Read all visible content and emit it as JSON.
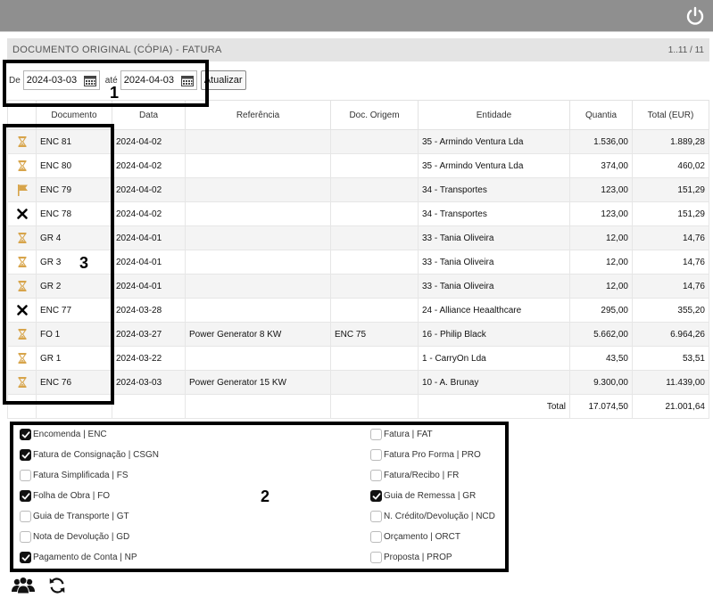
{
  "header": {
    "power_icon": "power-icon"
  },
  "panel": {
    "title": "DOCUMENTO ORIGINAL (CÓPIA) - FATURA",
    "pagination": "1..11 / 11"
  },
  "filter": {
    "from_label": "De",
    "from_value": "2024-03-03",
    "to_label": "até",
    "to_value": "2024-04-03",
    "refresh_label": "Atualizar"
  },
  "markers": {
    "m1": "1",
    "m2": "2",
    "m3": "3"
  },
  "table": {
    "columns": [
      "Documento",
      "Data",
      "Referência",
      "Doc. Origem",
      "Entidade",
      "Quantia",
      "Total (EUR)"
    ],
    "rows": [
      {
        "status": "hourglass",
        "doc": "ENC 81",
        "date": "2024-04-02",
        "ref": "",
        "origin": "",
        "entity": "35 - Armindo Ventura Lda",
        "qty": "1.536,00",
        "total": "1.889,28"
      },
      {
        "status": "hourglass",
        "doc": "ENC 80",
        "date": "2024-04-02",
        "ref": "",
        "origin": "",
        "entity": "35 - Armindo Ventura Lda",
        "qty": "374,00",
        "total": "460,02"
      },
      {
        "status": "flag",
        "doc": "ENC 79",
        "date": "2024-04-02",
        "ref": "",
        "origin": "",
        "entity": "34 - Transportes",
        "qty": "123,00",
        "total": "151,29"
      },
      {
        "status": "cross",
        "doc": "ENC 78",
        "date": "2024-04-02",
        "ref": "",
        "origin": "",
        "entity": "34 - Transportes",
        "qty": "123,00",
        "total": "151,29"
      },
      {
        "status": "hourglass",
        "doc": "GR 4",
        "date": "2024-04-01",
        "ref": "",
        "origin": "",
        "entity": "33 - Tania Oliveira",
        "qty": "12,00",
        "total": "14,76"
      },
      {
        "status": "hourglass",
        "doc": "GR 3",
        "date": "2024-04-01",
        "ref": "",
        "origin": "",
        "entity": "33 - Tania Oliveira",
        "qty": "12,00",
        "total": "14,76"
      },
      {
        "status": "hourglass",
        "doc": "GR 2",
        "date": "2024-04-01",
        "ref": "",
        "origin": "",
        "entity": "33 - Tania Oliveira",
        "qty": "12,00",
        "total": "14,76"
      },
      {
        "status": "cross",
        "doc": "ENC 77",
        "date": "2024-03-28",
        "ref": "",
        "origin": "",
        "entity": "24 - Alliance Heaalthcare",
        "qty": "295,00",
        "total": "355,20"
      },
      {
        "status": "hourglass",
        "doc": "FO 1",
        "date": "2024-03-27",
        "ref": "Power Generator 8 KW",
        "origin": "ENC 75",
        "entity": "16 - Philip Black",
        "qty": "5.662,00",
        "total": "6.964,26"
      },
      {
        "status": "hourglass",
        "doc": "GR 1",
        "date": "2024-03-22",
        "ref": "",
        "origin": "",
        "entity": "1 - CarryOn Lda",
        "qty": "43,50",
        "total": "53,51"
      },
      {
        "status": "hourglass",
        "doc": "ENC 76",
        "date": "2024-03-03",
        "ref": "Power Generator 15 KW",
        "origin": "",
        "entity": "10 - A. Brunay",
        "qty": "9.300,00",
        "total": "11.439,00"
      }
    ],
    "total_label": "Total",
    "total_qty": "17.074,50",
    "total_total": "21.001,64"
  },
  "doc_types": {
    "left": [
      {
        "label": "Encomenda | ENC",
        "checked": true
      },
      {
        "label": "Fatura de Consignação | CSGN",
        "checked": true
      },
      {
        "label": "Fatura Simplificada | FS",
        "checked": false
      },
      {
        "label": "Folha de Obra | FO",
        "checked": true
      },
      {
        "label": "Guia de Transporte | GT",
        "checked": false
      },
      {
        "label": "Nota de Devolução | GD",
        "checked": false
      },
      {
        "label": "Pagamento de Conta | NP",
        "checked": true
      }
    ],
    "right": [
      {
        "label": "Fatura | FAT",
        "checked": false
      },
      {
        "label": "Fatura Pro Forma | PRO",
        "checked": false
      },
      {
        "label": "Fatura/Recibo | FR",
        "checked": false
      },
      {
        "label": "Guia de Remessa | GR",
        "checked": true
      },
      {
        "label": "N. Crédito/Devolução | NCD",
        "checked": false
      },
      {
        "label": "Orçamento | ORCT",
        "checked": false
      },
      {
        "label": "Proposta | PROP",
        "checked": false
      }
    ]
  },
  "footer": {
    "icons": [
      "users-icon",
      "refresh-icon"
    ]
  },
  "colors": {
    "topbar": "#8f8f8f",
    "status_icon": "#d7a44a",
    "cross": "#000000"
  }
}
